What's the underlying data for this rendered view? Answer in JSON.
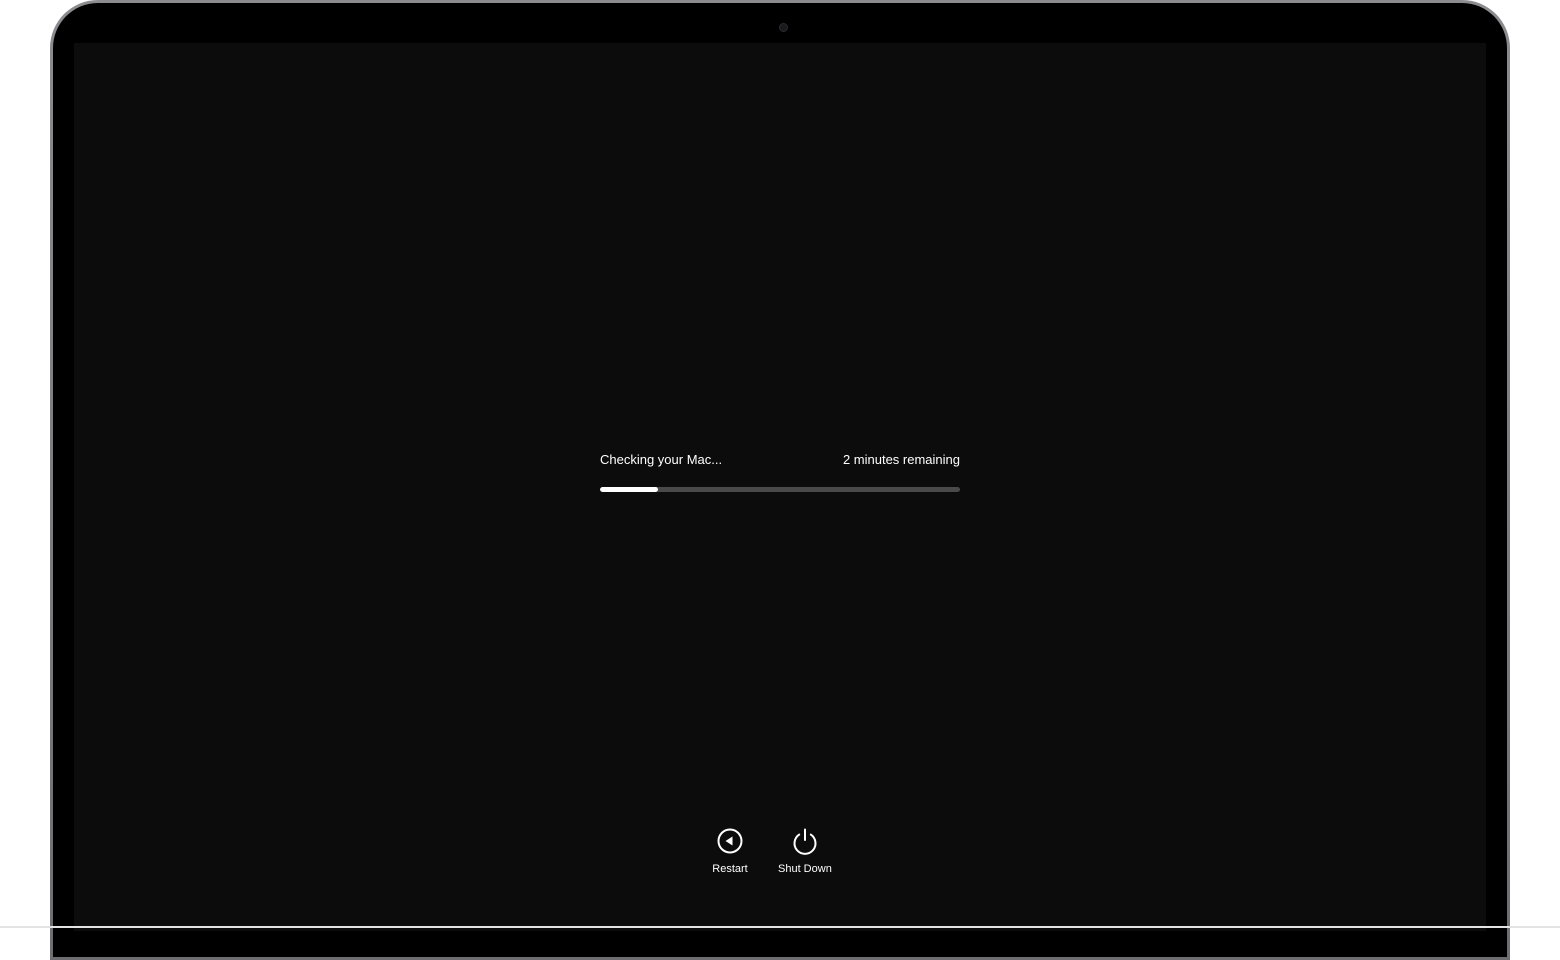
{
  "status": {
    "message": "Checking your Mac...",
    "time_remaining": "2 minutes remaining",
    "progress": 0.16
  },
  "actions": {
    "restart_label": "Restart",
    "restart_icon": "restart-icon",
    "shutdown_label": "Shut Down",
    "shutdown_icon": "power-icon"
  },
  "colors": {
    "screen_background": "#0c0c0c",
    "progress_fill": "#ffffff",
    "progress_track": "#4a4a4a",
    "text": "#ffffff"
  }
}
